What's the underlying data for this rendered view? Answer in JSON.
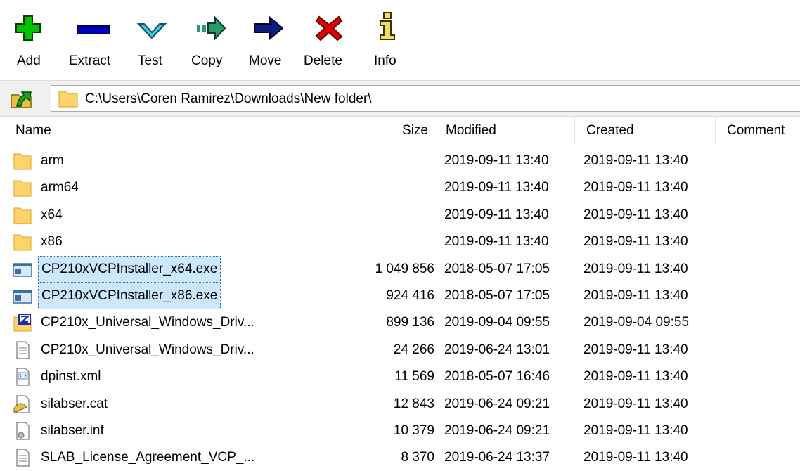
{
  "toolbar": {
    "buttons": [
      {
        "label": "Add",
        "icon": "add-icon",
        "color": "#00c000"
      },
      {
        "label": "Extract",
        "icon": "extract-icon",
        "color": "#0000c0"
      },
      {
        "label": "Test",
        "icon": "test-icon",
        "color": "#40c8e0"
      },
      {
        "label": "Copy",
        "icon": "copy-icon",
        "color": "#2a9a6a"
      },
      {
        "label": "Move",
        "icon": "move-icon",
        "color": "#0a1e7a"
      },
      {
        "label": "Delete",
        "icon": "delete-icon",
        "color": "#e00000"
      },
      {
        "label": "Info",
        "icon": "info-icon",
        "color": "#806000"
      }
    ]
  },
  "address": {
    "path": "C:\\Users\\Coren Ramirez\\Downloads\\New folder\\"
  },
  "columns": {
    "name": "Name",
    "size": "Size",
    "modified": "Modified",
    "created": "Created",
    "comment": "Comment"
  },
  "rows": [
    {
      "name": "arm",
      "size": "",
      "modified": "2019-09-11 13:40",
      "created": "2019-09-11 13:40",
      "icon": "folder-icon",
      "selected": false
    },
    {
      "name": "arm64",
      "size": "",
      "modified": "2019-09-11 13:40",
      "created": "2019-09-11 13:40",
      "icon": "folder-icon",
      "selected": false
    },
    {
      "name": "x64",
      "size": "",
      "modified": "2019-09-11 13:40",
      "created": "2019-09-11 13:40",
      "icon": "folder-icon",
      "selected": false
    },
    {
      "name": "x86",
      "size": "",
      "modified": "2019-09-11 13:40",
      "created": "2019-09-11 13:40",
      "icon": "folder-icon",
      "selected": false
    },
    {
      "name": "CP210xVCPInstaller_x64.exe",
      "size": "1 049 856",
      "modified": "2018-05-07 17:05",
      "created": "2019-09-11 13:40",
      "icon": "exe-icon",
      "selected": true
    },
    {
      "name": "CP210xVCPInstaller_x86.exe",
      "size": "924 416",
      "modified": "2018-05-07 17:05",
      "created": "2019-09-11 13:40",
      "icon": "exe-icon",
      "selected": true
    },
    {
      "name": "CP210x_Universal_Windows_Driv...",
      "size": "899 136",
      "modified": "2019-09-04 09:55",
      "created": "2019-09-04 09:55",
      "icon": "zip-icon",
      "selected": false
    },
    {
      "name": "CP210x_Universal_Windows_Driv...",
      "size": "24 266",
      "modified": "2019-06-24 13:01",
      "created": "2019-09-11 13:40",
      "icon": "text-file-icon",
      "selected": false
    },
    {
      "name": "dpinst.xml",
      "size": "11 569",
      "modified": "2018-05-07 16:46",
      "created": "2019-09-11 13:40",
      "icon": "xml-file-icon",
      "selected": false
    },
    {
      "name": "silabser.cat",
      "size": "12 843",
      "modified": "2019-06-24 09:21",
      "created": "2019-09-11 13:40",
      "icon": "cat-file-icon",
      "selected": false
    },
    {
      "name": "silabser.inf",
      "size": "10 379",
      "modified": "2019-06-24 09:21",
      "created": "2019-09-11 13:40",
      "icon": "inf-file-icon",
      "selected": false
    },
    {
      "name": "SLAB_License_Agreement_VCP_...",
      "size": "8 370",
      "modified": "2019-06-24 13:37",
      "created": "2019-09-11 13:40",
      "icon": "text-file-icon",
      "selected": false
    }
  ]
}
